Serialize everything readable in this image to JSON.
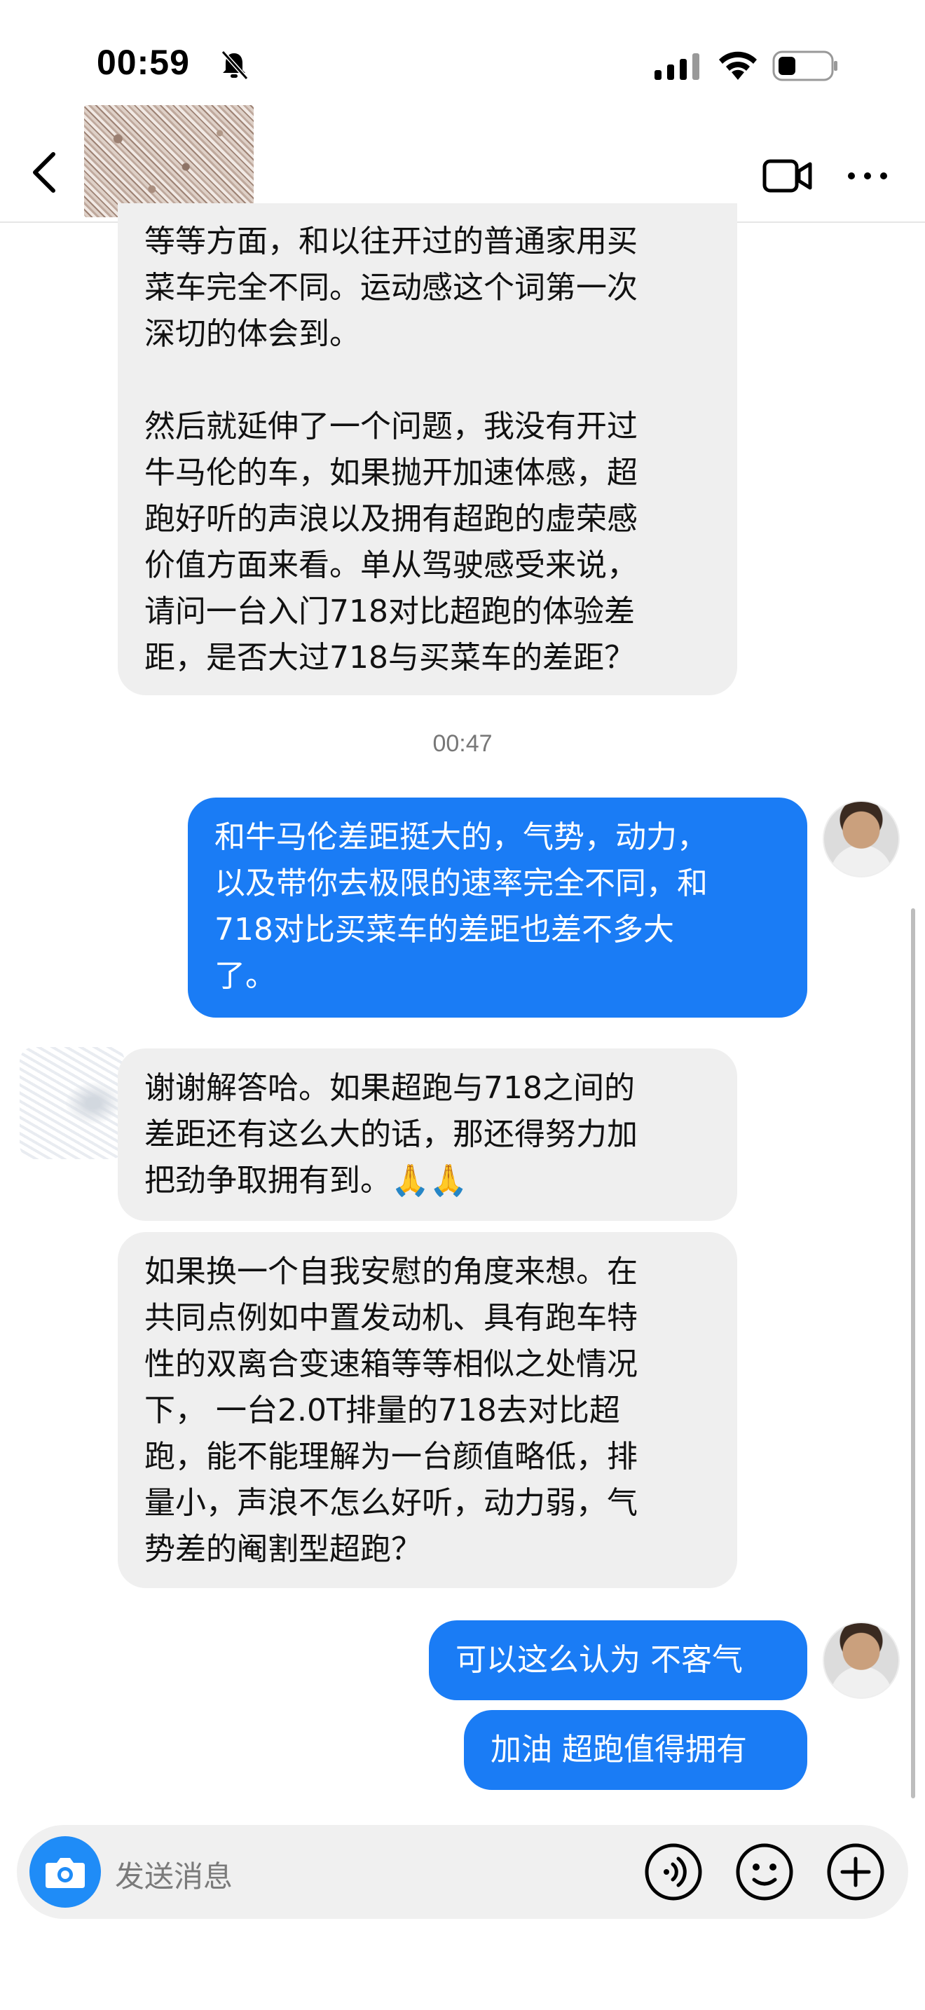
{
  "status_bar": {
    "time": "00:59"
  },
  "messages": [
    {
      "side": "in",
      "text": "等等方面，和以往开过的普通家用买\n菜车完全不同。运动感这个词第一次\n深切的体会到。\n\n然后就延伸了一个问题，我没有开过\n牛马伦的车，如果抛开加速体感，超\n跑好听的声浪以及拥有超跑的虚荣感\n价值方面来看。单从驾驶感受来说，\n请问一台入门718对比超跑的体验差\n距，是否大过718与买菜车的差距？"
    },
    {
      "side": "timestamp",
      "text": "00:47"
    },
    {
      "side": "out",
      "text": "和牛马伦差距挺大的，气势，动力，\n以及带你去极限的速率完全不同，和\n718对比买菜车的差距也差不多大\n了。"
    },
    {
      "side": "in",
      "text": "谢谢解答哈。如果超跑与718之间的\n差距还有这么大的话，那还得努力加\n把劲争取拥有到。🙏🙏"
    },
    {
      "side": "in",
      "text": "如果换一个自我安慰的角度来想。在\n共同点例如中置发动机、具有跑车特\n性的双离合变速箱等等相似之处情况\n下， 一台2.0T排量的718去对比超\n跑，能不能理解为一台颜值略低，排\n量小，声浪不怎么好听，动力弱，气\n势差的阉割型超跑？"
    },
    {
      "side": "out",
      "text": "可以这么认为 不客气"
    },
    {
      "side": "out",
      "text": "加油 超跑值得拥有"
    }
  ],
  "input": {
    "placeholder": "发送消息"
  },
  "colors": {
    "outgoing_bubble": "#1a7cf5",
    "incoming_bubble": "#efefef",
    "camera_button": "#1f8cf7"
  },
  "icons": [
    "back-icon",
    "video-camera-icon",
    "more-icon",
    "camera-icon",
    "voice-icon",
    "emoji-icon",
    "plus-icon",
    "bell-muted-icon",
    "signal-icon",
    "wifi-icon",
    "battery-icon"
  ]
}
